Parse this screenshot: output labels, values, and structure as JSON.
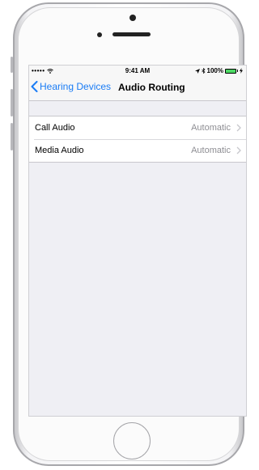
{
  "status_bar": {
    "signal": "••••• ",
    "time": "9:41 AM",
    "battery_percent": "100%",
    "battery_level": 1.0
  },
  "nav": {
    "back_label": "Hearing Devices",
    "title": "Audio Routing"
  },
  "settings": [
    {
      "label": "Call Audio",
      "value": "Automatic"
    },
    {
      "label": "Media Audio",
      "value": "Automatic"
    }
  ],
  "icons": {
    "back": "chevron-left-icon",
    "disclosure": "chevron-right-icon",
    "wifi": "wifi-icon",
    "location": "location-arrow-icon",
    "bluetooth": "bluetooth-icon",
    "battery": "battery-icon",
    "charging": "charging-bolt-icon"
  },
  "colors": {
    "accent": "#1a7cf5",
    "battery_fill": "#4cd964",
    "secondary_text": "#8e8e93",
    "background": "#efeff4"
  }
}
